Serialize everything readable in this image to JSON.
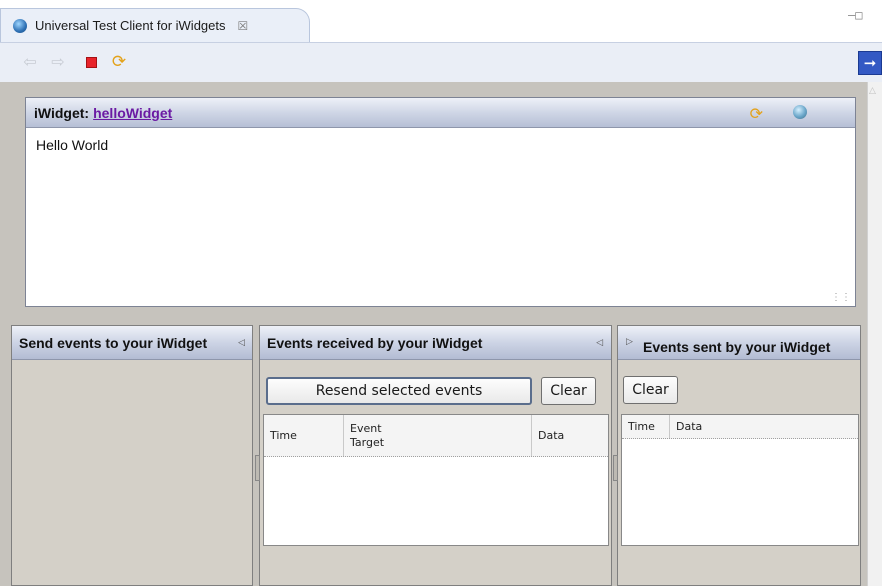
{
  "tab": {
    "title": "Universal Test Client for iWidgets",
    "close": "☒"
  },
  "widget": {
    "label": "iWidget:",
    "link": "helloWidget",
    "content": "Hello World"
  },
  "panels": {
    "send": {
      "title": "Send events to your iWidget"
    },
    "received": {
      "title": "Events received by your iWidget",
      "resend_label": "Resend selected events",
      "clear_label": "Clear",
      "columns": {
        "time": "Time",
        "event": "Event",
        "target": "Target",
        "data": "Data"
      }
    },
    "sent": {
      "title": "Events sent by your iWidget",
      "clear_label": "Clear",
      "columns": {
        "time": "Time",
        "data": "Data"
      }
    }
  },
  "colors": {
    "accent": "#3359c4",
    "link": "#6b1aa3",
    "stop": "#e8232a",
    "panel_bg": "#d4d0c8"
  }
}
